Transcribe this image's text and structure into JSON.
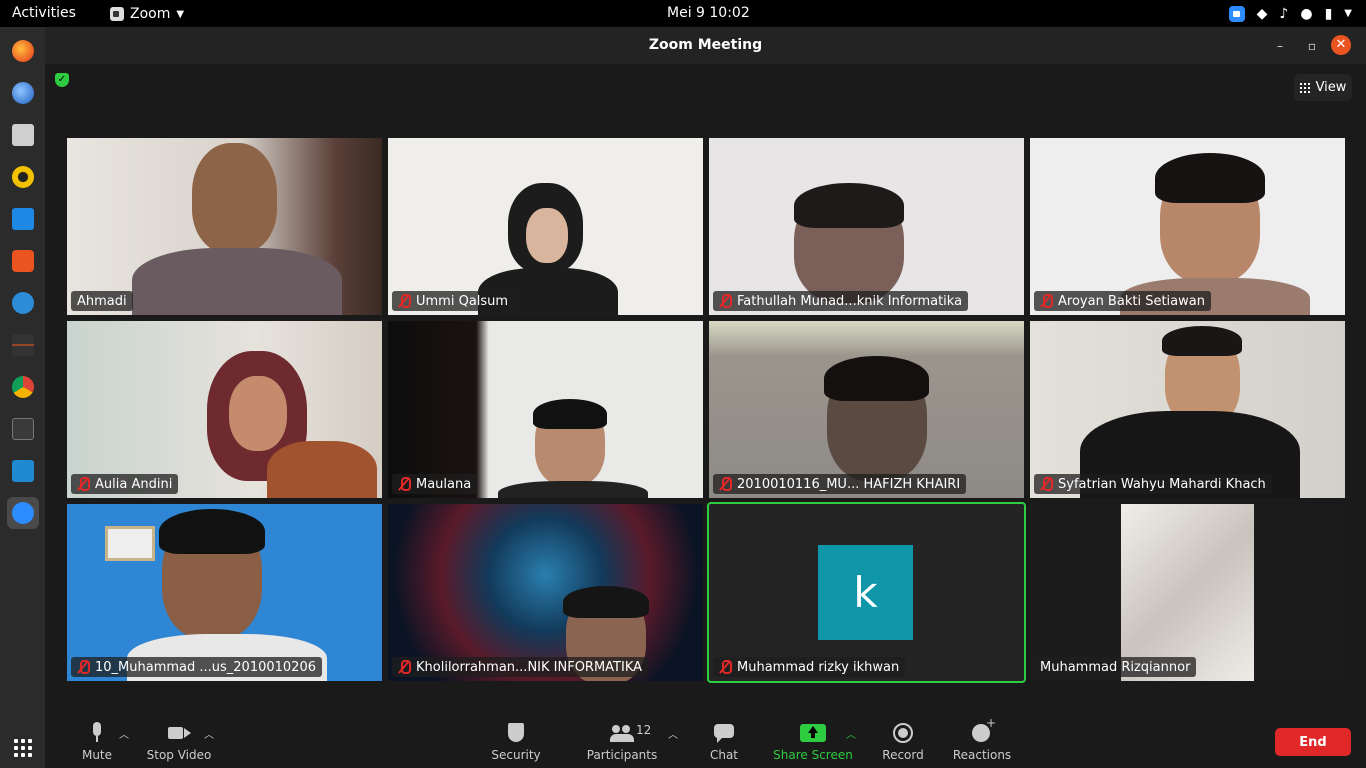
{
  "topbar": {
    "activities": "Activities",
    "app_name": "Zoom",
    "clock": "Mei 9  10:02"
  },
  "window": {
    "title": "Zoom Meeting",
    "view_label": "View"
  },
  "tiles": [
    {
      "name": "Ahmadi",
      "muted": false
    },
    {
      "name": "Ummi Qalsum",
      "muted": true
    },
    {
      "name": "Fathullah Munad...knik Informatika",
      "muted": true
    },
    {
      "name": "Aroyan Bakti Setiawan",
      "muted": true
    },
    {
      "name": "Aulia Andini",
      "muted": true
    },
    {
      "name": "Maulana",
      "muted": true
    },
    {
      "name": "2010010116_MU... HAFIZH KHAIRI",
      "muted": true
    },
    {
      "name": "Syfatrian Wahyu Mahardi Khach",
      "muted": true
    },
    {
      "name": "10_Muhammad ...us_2010010206",
      "muted": true
    },
    {
      "name": "Kholilorrahman...NIK INFORMATIKA",
      "muted": true
    },
    {
      "name": "Muhammad rizky ikhwan",
      "muted": true,
      "avatar_letter": "k",
      "active_speaker": true
    },
    {
      "name": "Muhammad Rizqiannor",
      "muted": false
    }
  ],
  "toolbar": {
    "mute": "Mute",
    "stop_video": "Stop Video",
    "security": "Security",
    "participants": "Participants",
    "participants_count": "12",
    "chat": "Chat",
    "share_screen": "Share Screen",
    "record": "Record",
    "reactions": "Reactions",
    "end": "End"
  },
  "colors": {
    "accent_green": "#2ecc40",
    "end_red": "#e02828",
    "avatar_teal": "#0f96a8"
  }
}
